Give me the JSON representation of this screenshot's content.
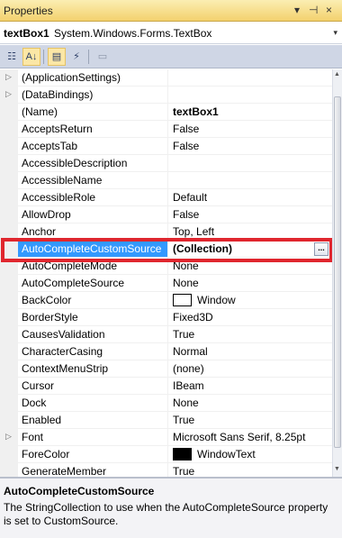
{
  "window": {
    "title": "Properties"
  },
  "title_icons": {
    "dropdown": "▾",
    "pin": "⊣",
    "close": "×"
  },
  "object_selector": {
    "name": "textBox1",
    "type": "System.Windows.Forms.TextBox",
    "dropdown_glyph": "▾"
  },
  "toolbar": {
    "categorized": "☷",
    "alphabetical": "A↓",
    "properties": "▤",
    "events": "⚡",
    "property_pages": "▭"
  },
  "properties": [
    {
      "name": "(ApplicationSettings)",
      "value": "",
      "expandable": true
    },
    {
      "name": "(DataBindings)",
      "value": "",
      "expandable": true
    },
    {
      "name": "(Name)",
      "value": "textBox1",
      "bold": true
    },
    {
      "name": "AcceptsReturn",
      "value": "False"
    },
    {
      "name": "AcceptsTab",
      "value": "False"
    },
    {
      "name": "AccessibleDescription",
      "value": ""
    },
    {
      "name": "AccessibleName",
      "value": ""
    },
    {
      "name": "AccessibleRole",
      "value": "Default"
    },
    {
      "name": "AllowDrop",
      "value": "False"
    },
    {
      "name": "Anchor",
      "value": "Top, Left"
    },
    {
      "name": "AutoCompleteCustomSource",
      "value": "(Collection)",
      "bold": true,
      "selected": true,
      "ellipsis": "..."
    },
    {
      "name": "AutoCompleteMode",
      "value": "None"
    },
    {
      "name": "AutoCompleteSource",
      "value": "None"
    },
    {
      "name": "BackColor",
      "value": "Window",
      "swatch": "#ffffff"
    },
    {
      "name": "BorderStyle",
      "value": "Fixed3D"
    },
    {
      "name": "CausesValidation",
      "value": "True"
    },
    {
      "name": "CharacterCasing",
      "value": "Normal"
    },
    {
      "name": "ContextMenuStrip",
      "value": "(none)"
    },
    {
      "name": "Cursor",
      "value": "IBeam"
    },
    {
      "name": "Dock",
      "value": "None"
    },
    {
      "name": "Enabled",
      "value": "True"
    },
    {
      "name": "Font",
      "value": "Microsoft Sans Serif, 8.25pt",
      "expandable": true
    },
    {
      "name": "ForeColor",
      "value": "WindowText",
      "swatch": "#000000"
    },
    {
      "name": "GenerateMember",
      "value": "True"
    }
  ],
  "description": {
    "title": "AutoCompleteCustomSource",
    "text": "The StringCollection to use when the AutoCompleteSource property is set to CustomSource."
  },
  "colors": {
    "selection": "#3399ff",
    "highlight_box": "#e0262e",
    "titlebar": "#f3d16e"
  }
}
